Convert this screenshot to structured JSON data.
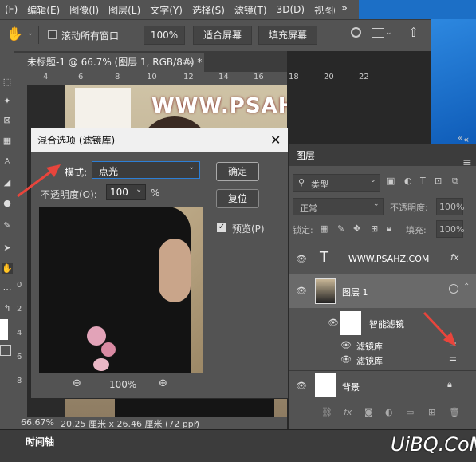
{
  "menu": [
    "(F)",
    "编辑(E)",
    "图像(I)",
    "图层(L)",
    "文字(Y)",
    "选择(S)",
    "滤镜(T)",
    "3D(D)",
    "视图(V)"
  ],
  "menu_more": "»",
  "options": {
    "scroll_all_label": "滚动所有窗口",
    "zoom_value": "100%",
    "fit_screen": "适合屏幕",
    "fill_screen": "填充屏幕"
  },
  "document": {
    "tab_title": "未标题-1 @ 66.7% (图层 1, RGB/8#) *",
    "close": "×"
  },
  "ruler_ticks": [
    "4",
    "6",
    "8",
    "10",
    "12",
    "14",
    "16",
    "18",
    "20",
    "22"
  ],
  "vruler_ticks": [
    "0",
    "2",
    "4",
    "6",
    "8"
  ],
  "canvas": {
    "watermark": "WWW.PSAHZ.COM"
  },
  "status": {
    "zoom": "66.67%",
    "size": "20.25 厘米 x 26.46 厘米 (72 ppi)",
    "arrow": "›"
  },
  "timeline_label": "时间轴",
  "dialog": {
    "title": "混合选项 (滤镜库)",
    "mode_label": "模式:",
    "mode_value": "点光",
    "opacity_label": "不透明度(O):",
    "opacity_value": "100",
    "opacity_unit": "%",
    "ok": "确定",
    "reset": "复位",
    "preview_label": "预览(P)",
    "zoom_value": "100%",
    "zoom_out": "⊖",
    "zoom_in": "⊕"
  },
  "layers_panel": {
    "tab": "图层",
    "filter_kind": "类型",
    "blend_mode": "正常",
    "opacity_label": "不透明度:",
    "opacity_value": "100%",
    "lock_label": "锁定:",
    "fill_label": "填充:",
    "fill_value": "100%",
    "layers": [
      {
        "name": "WWW.PSAHZ.COM",
        "kind": "text"
      },
      {
        "name": "图层 1",
        "kind": "smart-object"
      },
      {
        "name": "智能滤镜",
        "kind": "smart-filter"
      },
      {
        "name": "滤镜库",
        "kind": "filter"
      },
      {
        "name": "滤镜库",
        "kind": "filter"
      },
      {
        "name": "背景",
        "kind": "background"
      }
    ]
  },
  "footer_logo": "UiBQ.CoM",
  "colors": {
    "panel": "#535353",
    "dark": "#3c3c3c",
    "accent_arrow": "#e8453c",
    "desktop": "#1e74c8"
  }
}
